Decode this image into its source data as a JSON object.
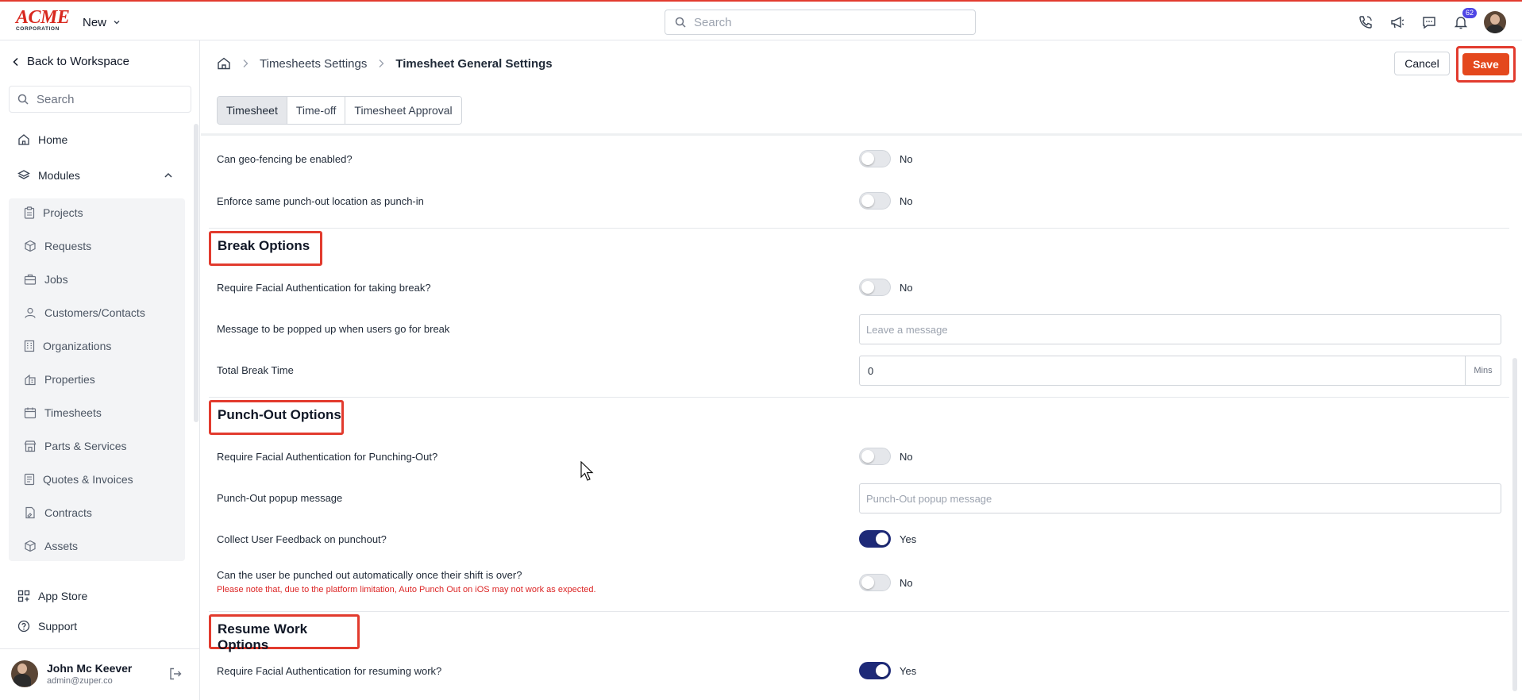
{
  "header": {
    "logo_main": "ACME",
    "logo_sub": "CORPORATION",
    "new_label": "New",
    "search_placeholder": "Search",
    "notification_count": "62"
  },
  "sidebar": {
    "back_label": "Back to Workspace",
    "search_placeholder": "Search",
    "home": "Home",
    "modules": "Modules",
    "module_items": [
      "Projects",
      "Requests",
      "Jobs",
      "Customers/Contacts",
      "Organizations",
      "Properties",
      "Timesheets",
      "Parts & Services",
      "Quotes & Invoices",
      "Contracts",
      "Assets"
    ],
    "app_store": "App Store",
    "support": "Support",
    "user": {
      "name": "John Mc Keever",
      "email": "admin@zuper.co"
    }
  },
  "main": {
    "breadcrumb": {
      "parent": "Timesheets Settings",
      "current": "Timesheet General Settings"
    },
    "cancel_label": "Cancel",
    "save_label": "Save",
    "tabs": [
      "Timesheet",
      "Time-off",
      "Timesheet Approval"
    ],
    "rows": {
      "geofencing": {
        "label": "Can geo-fencing be enabled?",
        "state": "No"
      },
      "same_location": {
        "label": "Enforce same punch-out location as punch-in",
        "state": "No"
      },
      "break_facial": {
        "label": "Require Facial Authentication for taking break?",
        "state": "No"
      },
      "break_message": {
        "label": "Message to be popped up when users go for break",
        "placeholder": "Leave a message"
      },
      "total_break": {
        "label": "Total Break Time",
        "value": "0",
        "unit": "Mins"
      },
      "punchout_facial": {
        "label": "Require Facial Authentication for Punching-Out?",
        "state": "No"
      },
      "punchout_message": {
        "label": "Punch-Out popup message",
        "placeholder": "Punch-Out popup message"
      },
      "feedback": {
        "label": "Collect User Feedback on punchout?",
        "state": "Yes"
      },
      "auto_punchout": {
        "label": "Can the user be punched out automatically once their shift is over?",
        "warning": "Please note that, due to the platform limitation, Auto Punch Out on iOS may not work as expected.",
        "state": "No"
      },
      "resume_facial": {
        "label": "Require Facial Authentication for resuming work?",
        "state": "Yes"
      }
    },
    "sections": {
      "break": "Break Options",
      "punchout": "Punch-Out Options",
      "resume": "Resume Work Options"
    }
  }
}
